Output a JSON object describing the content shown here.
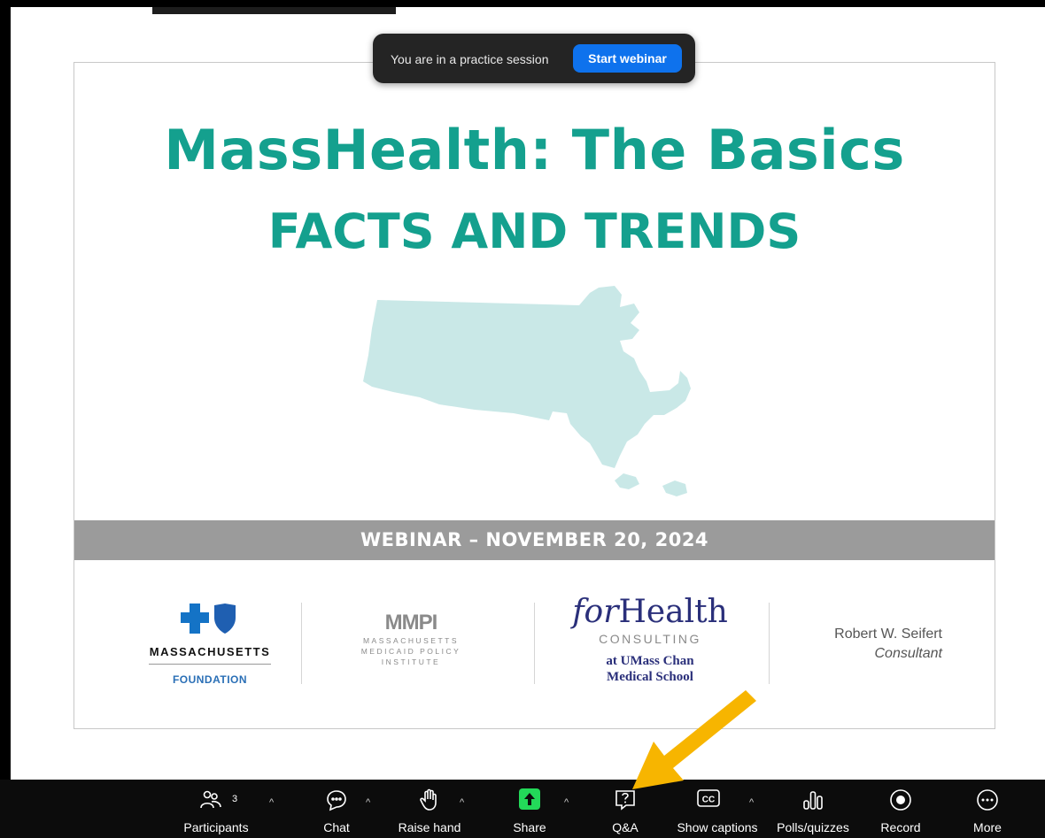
{
  "practice_banner": {
    "message": "You are in a practice session",
    "button_label": "Start webinar"
  },
  "slide": {
    "title": "MassHealth: The Basics",
    "subtitle": "FACTS AND TRENDS",
    "banner": "WEBINAR – NOVEMBER 20, 2024",
    "logos": {
      "bcbs_name": "MASSACHUSETTS",
      "bcbs_foundation": "FOUNDATION",
      "mmpi_logo": "MMPI",
      "mmpi_line1": "MASSACHUSETTS",
      "mmpi_line2": "MEDICAID POLICY",
      "mmpi_line3": "INSTITUTE",
      "forhealth_for": "for",
      "forhealth_health": "Health",
      "forhealth_consulting": "CONSULTING",
      "forhealth_umass1": "at UMass Chan",
      "forhealth_umass2": "Medical School"
    },
    "presenter_name": "Robert W. Seifert",
    "presenter_title": "Consultant"
  },
  "toolbar": {
    "participants_label": "Participants",
    "participants_count": "3",
    "chat_label": "Chat",
    "raise_hand_label": "Raise hand",
    "share_label": "Share",
    "qa_label": "Q&A",
    "captions_label": "Show captions",
    "polls_label": "Polls/quizzes",
    "record_label": "Record",
    "more_label": "More"
  },
  "colors": {
    "title_teal": "#14a08e",
    "map_fill": "#c9e8e7",
    "banner_gray": "#9b9b9b",
    "share_green": "#23d959",
    "start_blue": "#0e72ed",
    "arrow_yellow": "#f7b500"
  }
}
